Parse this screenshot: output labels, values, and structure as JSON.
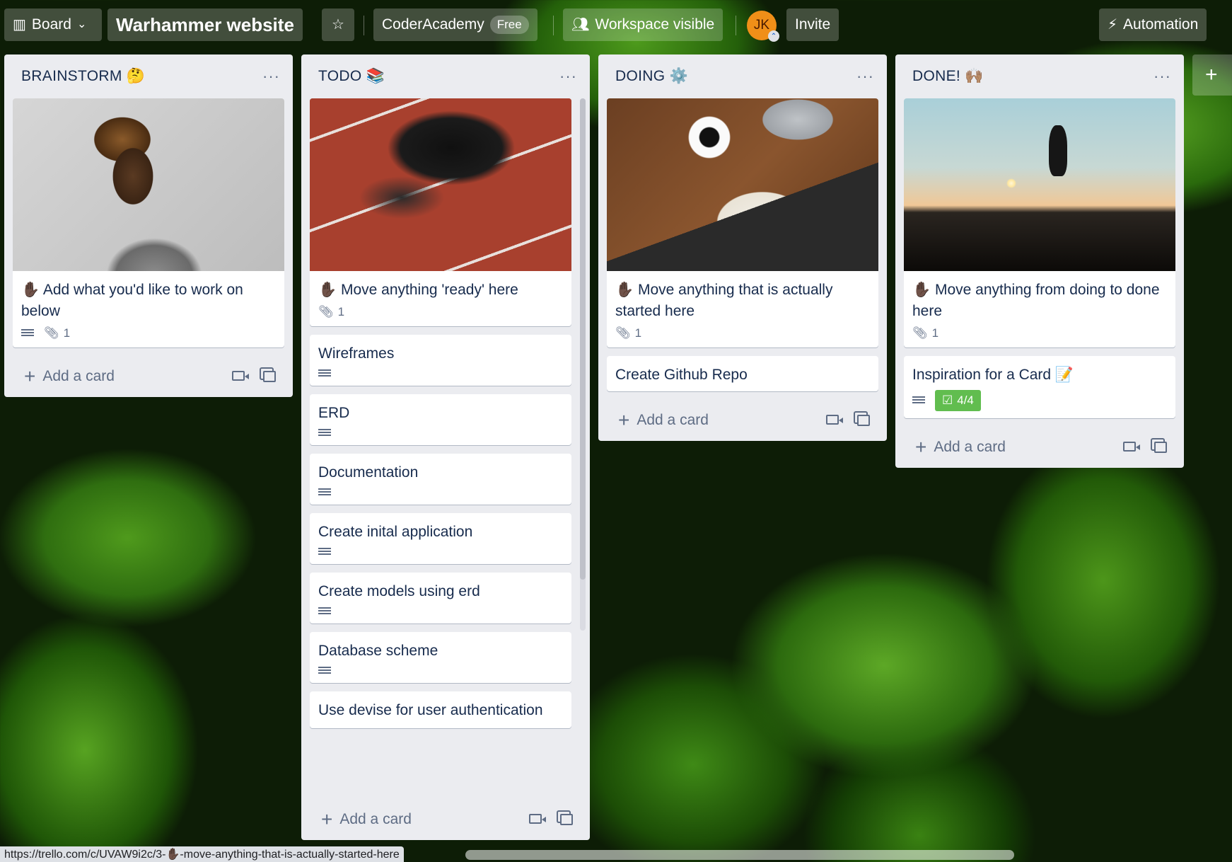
{
  "header": {
    "view_label": "Board",
    "board_title": "Warhammer website",
    "workspace_name": "CoderAcademy",
    "workspace_plan": "Free",
    "visibility_label": "Workspace visible",
    "avatar_initials": "JK",
    "invite_label": "Invite",
    "automation_label": "Automation"
  },
  "lists": [
    {
      "title": "BRAINSTORM 🤔",
      "cards": [
        {
          "title": "✋🏿 Add what you'd like to work on below",
          "has_description": true,
          "attachments": "1"
        }
      ],
      "add_label": "Add a card"
    },
    {
      "title": "TODO 📚",
      "cards": [
        {
          "title": "✋🏿 Move anything 'ready' here",
          "attachments": "1"
        },
        {
          "title": "Wireframes"
        },
        {
          "title": "ERD"
        },
        {
          "title": "Documentation"
        },
        {
          "title": "Create inital application"
        },
        {
          "title": "Create models using erd"
        },
        {
          "title": "Database scheme"
        },
        {
          "title": "Use devise for user authentication"
        }
      ],
      "add_label": "Add a card"
    },
    {
      "title": "DOING ⚙️",
      "cards": [
        {
          "title": "✋🏿 Move anything that is actually started here",
          "attachments": "1"
        },
        {
          "title": "Create Github Repo"
        }
      ],
      "add_label": "Add a card"
    },
    {
      "title": "DONE! 🙌🏽",
      "cards": [
        {
          "title": "✋🏿 Move anything from doing to done here",
          "attachments": "1"
        },
        {
          "title": "Inspiration for a Card 📝",
          "checklist": "4/4"
        }
      ],
      "add_label": "Add a card"
    }
  ],
  "add_list_label": "+",
  "status_url": "https://trello.com/c/UVAW9i2c/3-✋🏿-move-anything-that-is-actually-started-here",
  "colors": {
    "list_bg": "#ebecf0",
    "checklist_complete": "#61bd4f",
    "avatar": "#f08f18"
  }
}
